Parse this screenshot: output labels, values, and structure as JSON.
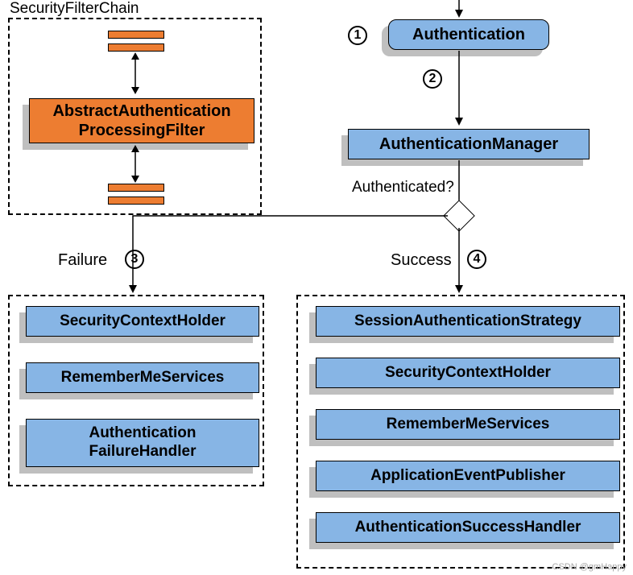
{
  "filterChain": {
    "title": "SecurityFilterChain",
    "mainFilter": "AbstractAuthentication\nProcessingFilter"
  },
  "flow": {
    "step1": "Authentication",
    "step2": "AuthenticationManager",
    "decisionLabel": "Authenticated?",
    "num1": "1",
    "num2": "2",
    "num3": "3",
    "num4": "4"
  },
  "failure": {
    "title": "Failure",
    "items": [
      "SecurityContextHolder",
      "RememberMeServices",
      "Authentication\nFailureHandler"
    ]
  },
  "success": {
    "title": "Success",
    "items": [
      "SessionAuthenticationStrategy",
      "SecurityContextHolder",
      "RememberMeServices",
      "ApplicationEventPublisher",
      "AuthenticationSuccessHandler"
    ]
  },
  "watermark": "CSDN @gmHappy"
}
